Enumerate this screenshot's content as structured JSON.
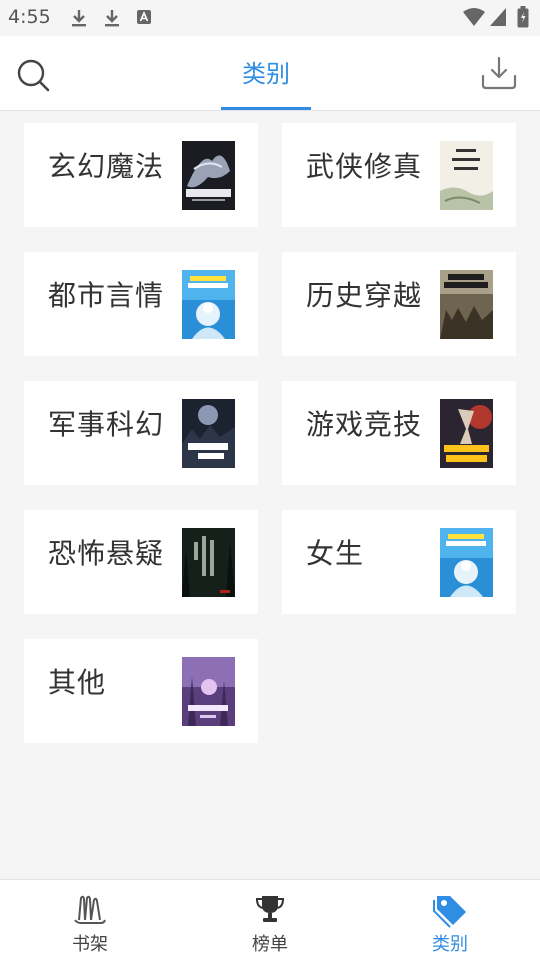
{
  "status_bar": {
    "time": "4:55"
  },
  "header": {
    "active_tab": "类别"
  },
  "categories": [
    {
      "label": "玄幻魔法",
      "cover": "dark-fantasy-cover"
    },
    {
      "label": "武侠修真",
      "cover": "ink-wash-cover"
    },
    {
      "label": "都市言情",
      "cover": "blue-anime-cover"
    },
    {
      "label": "历史穿越",
      "cover": "war-soldiers-cover"
    },
    {
      "label": "军事科幻",
      "cover": "night-scifi-cover"
    },
    {
      "label": "游戏竞技",
      "cover": "warrior-game-cover"
    },
    {
      "label": "恐怖悬疑",
      "cover": "dark-forest-cover"
    },
    {
      "label": "女生",
      "cover": "blue-anime-cover"
    },
    {
      "label": "其他",
      "cover": "purple-fantasy-cover"
    }
  ],
  "bottom_nav": {
    "items": [
      {
        "label": "书架",
        "icon": "bookshelf-icon"
      },
      {
        "label": "榜单",
        "icon": "trophy-icon"
      },
      {
        "label": "类别",
        "icon": "tag-icon"
      }
    ],
    "active_index": 2
  },
  "colors": {
    "accent": "#2f8de4",
    "background": "#f5f5f5"
  }
}
